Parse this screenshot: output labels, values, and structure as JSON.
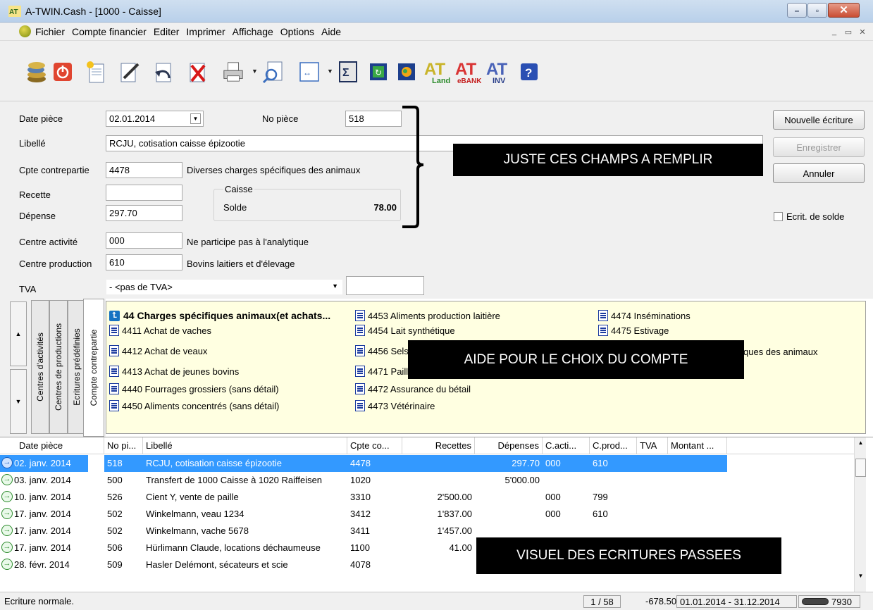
{
  "window": {
    "title": "A-TWIN.Cash - [1000 - Caisse]"
  },
  "menu": [
    "Fichier",
    "Compte financier",
    "Editer",
    "Imprimer",
    "Affichage",
    "Options",
    "Aide"
  ],
  "toolbar": {
    "icons": [
      "coins-icon",
      "power-icon",
      "new-document-icon",
      "edit-document-icon",
      "undo-document-icon",
      "delete-document-icon",
      "print-icon",
      "preview-icon",
      "zoom-fit-icon",
      "calculator-icon",
      "refresh-icon",
      "export-icon",
      "landi-icon",
      "ebank-icon",
      "inv-icon",
      "help-icon"
    ],
    "brand_labels": {
      "landi": "Landi",
      "ebank": "eBANK",
      "inv": "INV"
    }
  },
  "form": {
    "date_label": "Date pièce",
    "date_value": "02.01.2014",
    "no_piece_label": "No pièce",
    "no_piece_value": "518",
    "libelle_label": "Libellé",
    "libelle_value": "RCJU, cotisation caisse épizootie",
    "contrepartie_label": "Cpte contrepartie",
    "contrepartie_value": "4478",
    "contrepartie_desc": "Diverses charges spécifiques des animaux",
    "recette_label": "Recette",
    "recette_value": "",
    "depense_label": "Dépense",
    "depense_value": "297.70",
    "caisse_group_label": "Caisse",
    "solde_label": "Solde",
    "solde_value": "78.00",
    "centre_activite_label": "Centre activité",
    "centre_activite_value": "000",
    "centre_activite_desc": "Ne participe pas à l'analytique",
    "centre_production_label": "Centre production",
    "centre_production_value": "610",
    "centre_production_desc": "Bovins laitiers et d'élevage",
    "tva_label": "TVA",
    "tva_value": "- <pas de TVA>",
    "tva_extra": ""
  },
  "buttons": {
    "nouvelle": "Nouvelle écriture",
    "enregistrer": "Enregistrer",
    "annuler": "Annuler",
    "ecrit_solde": "Ecrit. de solde"
  },
  "annotations": {
    "fields": "JUSTE CES CHAMPS A REMPLIR",
    "help": "AIDE POUR LE CHOIX DU COMPTE",
    "history": "VISUEL DES ECRITURES PASSEES"
  },
  "side_tabs": [
    "Centres d'activités",
    "Centres de productions",
    "Ecritures prédéfinies",
    "Compte contrepartie"
  ],
  "accounts": {
    "group": "44  Charges spécifiques animaux(et achats...",
    "col1": [
      "4411 Achat de vaches",
      "4412 Achat de veaux",
      "4413 Achat de jeunes bovins",
      "4440 Fourrages grossiers (sans détail)",
      "4450 Aliments concentrés (sans détail)"
    ],
    "col2": [
      "4453 Aliments production laitière",
      "4454 Lait synthétique",
      "4456 Sels",
      "4471 Paill",
      "4472 Assurance du bétail",
      "4473 Vétérinaire"
    ],
    "col3": [
      "4474 Inséminations",
      "4475 Estivage",
      "ques des animaux"
    ]
  },
  "table": {
    "headers": [
      "Date pièce",
      "No pi...",
      "Libellé",
      "Cpte co...",
      "Recettes",
      "Dépenses",
      "C.acti...",
      "C.prod...",
      "TVA",
      "Montant ..."
    ],
    "rows": [
      [
        "02. janv. 2014",
        "518",
        "RCJU, cotisation caisse épizootie",
        "4478",
        "",
        "297.70",
        "000",
        "610",
        "",
        ""
      ],
      [
        "03. janv. 2014",
        "500",
        "Transfert de 1000 Caisse à 1020 Raiffeisen",
        "1020",
        "",
        "5'000.00",
        "",
        "",
        "",
        ""
      ],
      [
        "10. janv. 2014",
        "526",
        "Cient Y, vente de paille",
        "3310",
        "2'500.00",
        "",
        "000",
        "799",
        "",
        ""
      ],
      [
        "17. janv. 2014",
        "502",
        "Winkelmann, veau 1234",
        "3412",
        "1'837.00",
        "",
        "000",
        "610",
        "",
        ""
      ],
      [
        "17. janv. 2014",
        "502",
        "Winkelmann, vache 5678",
        "3411",
        "1'457.00",
        "",
        "",
        "",
        "",
        ""
      ],
      [
        "17. janv. 2014",
        "506",
        "Hürlimann Claude, locations déchaumeuse",
        "1100",
        "41.00",
        "",
        "",
        "",
        "",
        ""
      ],
      [
        "28. févr. 2014",
        "509",
        "Hasler Delémont, sécateurs et scie",
        "4078",
        "",
        "",
        "",
        "",
        "",
        ""
      ]
    ]
  },
  "status": {
    "text": "Ecriture normale.",
    "page": "1 / 58",
    "balance": "-678.50",
    "period": "01.01.2014 - 31.12.2014",
    "code": "7930"
  }
}
